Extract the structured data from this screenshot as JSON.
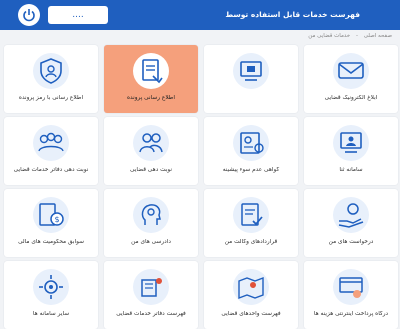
{
  "header": {
    "title": "فهرست خدمات قابل استفاده توسط",
    "user_button": "....",
    "power_icon": "power-icon"
  },
  "breadcrumb": [
    "صفحه اصلی",
    "خدمات قضایی من"
  ],
  "tiles": [
    {
      "label": "ابلاغ الکترونیک قضایی",
      "icon": "message-icon"
    },
    {
      "label": "",
      "icon": "computer-icon"
    },
    {
      "label": "اطلاع رسانی پرونده",
      "icon": "clipboard-hand-icon"
    },
    {
      "label": "اطلاع رسانی با رمز پرونده",
      "icon": "shield-user-icon"
    },
    {
      "label": "سامانه ثنا",
      "icon": "monitor-user-icon"
    },
    {
      "label": "گواهی عدم سوء پیشینه",
      "icon": "certificate-icon"
    },
    {
      "label": "نوبت دهی قضایی",
      "icon": "users-icon"
    },
    {
      "label": "نوبت دهی دفاتر خدمات قضایی",
      "icon": "people-group-icon"
    },
    {
      "label": "درخواست های من",
      "icon": "hand-money-icon"
    },
    {
      "label": "قراردادهای وکالت من",
      "icon": "contract-check-icon"
    },
    {
      "label": "دادرسی های من",
      "icon": "head-gear-icon"
    },
    {
      "label": "سوابق محکومیت های مالی",
      "icon": "document-dollar-icon"
    },
    {
      "label": "درگاه پرداخت اینترنتی هزینه ها",
      "icon": "payment-gateway-icon"
    },
    {
      "label": "فهرست واحدهای قضایی",
      "icon": "map-location-icon"
    },
    {
      "label": "فهرست دفاتر خدمات قضایی",
      "icon": "building-map-icon"
    },
    {
      "label": "سایر سامانه ها",
      "icon": "network-gear-icon"
    }
  ],
  "watermark": "درگاه ملی قوه قضائیه",
  "colors": {
    "header": "#1f5fbf",
    "accent": "#1f5fbf",
    "active_tile": "#f5a07c"
  }
}
